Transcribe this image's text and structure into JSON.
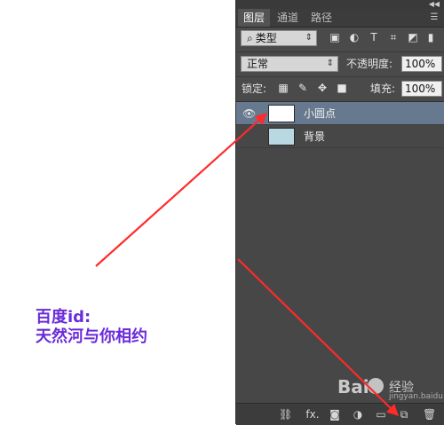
{
  "panel": {
    "tabs": [
      {
        "label": "图层",
        "active": true
      },
      {
        "label": "通道",
        "active": false
      },
      {
        "label": "路径",
        "active": false
      }
    ],
    "filter": {
      "value": "类型"
    },
    "blend_mode": {
      "value": "正常"
    },
    "opacity": {
      "label": "不透明度:",
      "value": "100%"
    },
    "lock": {
      "label": "锁定:"
    },
    "fill": {
      "label": "填充:",
      "value": "100%"
    },
    "layers": [
      {
        "name": "小圆点",
        "thumbnail_color": "#ffffff",
        "selected": true,
        "visible": true
      },
      {
        "name": "背景",
        "thumbnail_color": "#b9d8e2",
        "selected": false,
        "visible": false
      }
    ],
    "bottom_bar": {
      "fx_label": "fx."
    }
  },
  "annotation": {
    "line1": "百度id:",
    "line2": "天然河与你相约"
  },
  "watermark": {
    "brand_left": "Bai",
    "brand_right": "经验",
    "brand_sub": "jingyan.baidu.com"
  },
  "colors": {
    "panel_bg": "#4a4a4a",
    "selected_layer": "#67798f",
    "arrow": "#ff2a2a",
    "annotation_text": "#6a2bd9"
  }
}
